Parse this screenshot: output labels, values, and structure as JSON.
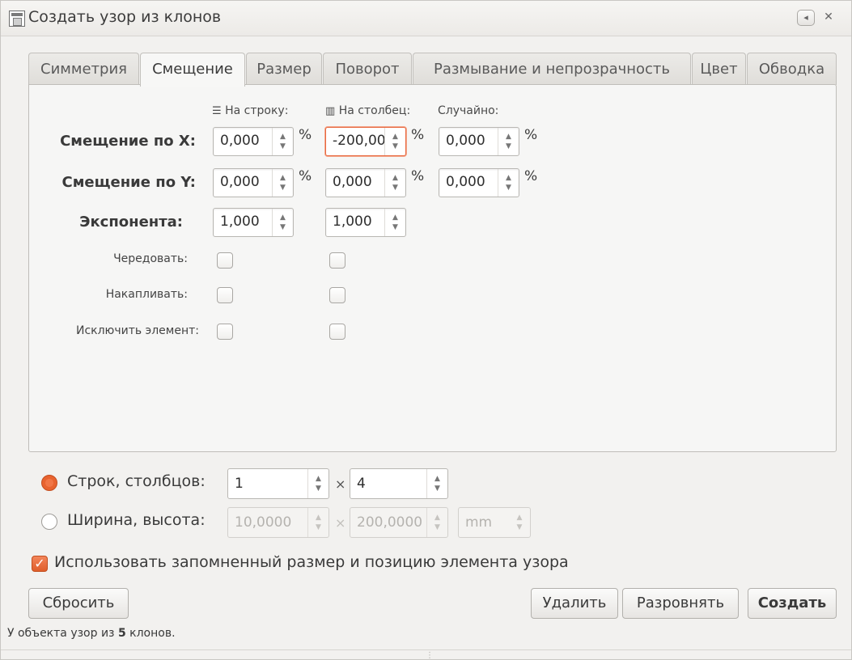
{
  "window": {
    "title": "Создать узор из клонов",
    "collapse_label": "◂",
    "close_label": "✕"
  },
  "tabs": [
    {
      "label": "Симметрия"
    },
    {
      "label": "Смещение"
    },
    {
      "label": "Размер"
    },
    {
      "label": "Поворот"
    },
    {
      "label": "Размывание и непрозрачность"
    },
    {
      "label": "Цвет"
    },
    {
      "label": "Обводка"
    }
  ],
  "active_tab": "Смещение",
  "shift": {
    "columns": {
      "per_row": "На строку:",
      "per_column": "На столбец:",
      "random": "Случайно:"
    },
    "row_x": {
      "label": "Смещение по X:",
      "per_row": "0,000",
      "per_column": "-200,00",
      "random": "0,000",
      "unit": "%"
    },
    "row_y": {
      "label": "Смещение по Y:",
      "per_row": "0,000",
      "per_column": "0,000",
      "random": "0,000",
      "unit": "%"
    },
    "exponent": {
      "label": "Экспонента:",
      "per_row": "1,000",
      "per_column": "1,000"
    },
    "alternate": {
      "label": "Чередовать:"
    },
    "cumulate": {
      "label": "Накапливать:"
    },
    "exclude": {
      "label": "Исключить элемент:"
    }
  },
  "layout_mode": {
    "rows_cols": {
      "label": "Строк, столбцов:",
      "rows": "1",
      "cols": "4",
      "selected": true
    },
    "width_height": {
      "label": "Ширина, высота:",
      "width": "10,0000",
      "height": "200,0000",
      "unit": "mm",
      "selected": false
    },
    "times": "×"
  },
  "remember": {
    "label": "Использовать запомненный размер и позицию элемента узора",
    "checked": true
  },
  "buttons": {
    "reset": "Сбросить",
    "remove": "Удалить",
    "unclump": "Разровнять",
    "create": "Создать"
  },
  "status": {
    "prefix": "У объекта узор из ",
    "count": "5",
    "suffix": " клонов."
  },
  "colors": {
    "accent": "#e8632f",
    "focus_border": "#e8683f"
  }
}
